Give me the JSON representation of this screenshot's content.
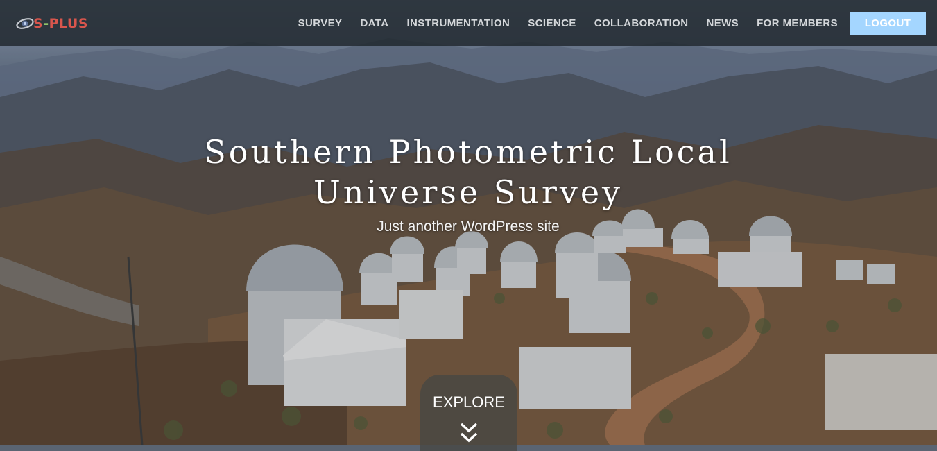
{
  "brand": {
    "logo_text": "S-PLUS"
  },
  "nav": {
    "items": [
      {
        "label": "SURVEY"
      },
      {
        "label": "DATA"
      },
      {
        "label": "INSTRUMENTATION"
      },
      {
        "label": "SCIENCE"
      },
      {
        "label": "COLLABORATION"
      },
      {
        "label": "NEWS"
      },
      {
        "label": "FOR MEMBERS"
      }
    ],
    "logout_label": "LOGOUT"
  },
  "hero": {
    "title": "Southern Photometric Local Universe Survey",
    "subtitle": "Just another WordPress site",
    "explore_label": "EXPLORE"
  },
  "colors": {
    "accent": "#a4d6ff",
    "navbar_bg": "#1e262c",
    "logo_red": "#d9564d",
    "logo_green": "#8fc26b"
  },
  "icons": {
    "logo": "galaxy-logo-icon",
    "explore": "double-chevron-down-icon"
  }
}
